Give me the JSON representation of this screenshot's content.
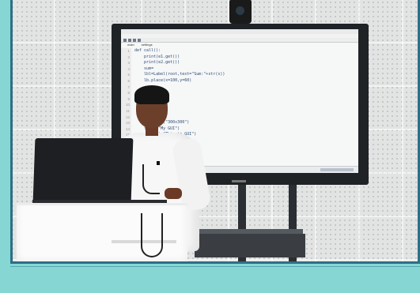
{
  "scene": {
    "description_free": true,
    "colors": {
      "frame": "#86d7d4",
      "border": "#2d6f86",
      "wall": "#e2e4e3",
      "tv": "#1f2326",
      "shirt": "#f7f7f7"
    },
    "screen": {
      "tabs": [
        "main",
        "settings"
      ],
      "code_lines": [
        "def call():",
        "    print(e1.get())",
        "    print(e2.get())",
        "    sum=",
        "    lbl=Label(root,text=\"Sum:\"+str(s))",
        "    lb.place(x=100,y=60)",
        "",
        "",
        "",
        "",
        "",
        "",
        "    geometry(\"300x300\")",
        "    title(\"My GUI\")",
        "       text=\"This is GUI\")"
      ],
      "line_numbers": [
        "1",
        "2",
        "3",
        "4",
        "5",
        "6",
        "7",
        "8",
        "9",
        "10",
        "11",
        "12",
        "13",
        "14",
        "15"
      ]
    }
  }
}
